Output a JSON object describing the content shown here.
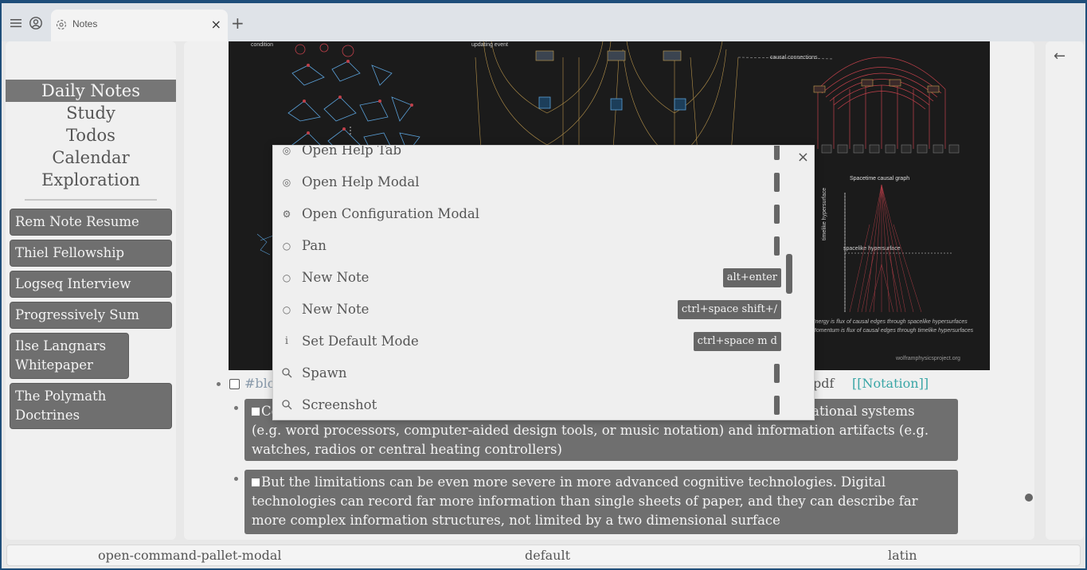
{
  "tab": {
    "title": "Notes",
    "close": "×",
    "new": "+"
  },
  "sidebar": {
    "nav": [
      {
        "label": "Daily Notes",
        "active": true
      },
      {
        "label": "Study"
      },
      {
        "label": "Todos"
      },
      {
        "label": "Calendar"
      },
      {
        "label": "Exploration"
      }
    ],
    "pages": [
      "Rem Note Resume",
      "Thiel Fellowship",
      "Logseq Interview",
      "Progressively Sum",
      "Ilse Langnars Whitepaper",
      "The Polymath Doctrines"
    ]
  },
  "figure": {
    "labels": {
      "condition": "condition",
      "updating_event": "updating event",
      "causal_connections": "causal connections",
      "spacetime_causal_graph": "Spacetime causal graph",
      "spacelike_hypersurface": "spacelike hypersurface",
      "timelike_hypersurface": "timelike hypersurface",
      "energy_caption": "Energy is flux of causal edges through spacelike hypersurfaces",
      "momentum_caption": "Momentum is flux of causal edges through timelike hypersurfaces",
      "credit": "wolframphysicsproject.org"
    }
  },
  "block": {
    "tag": "#blo",
    "file": "y.pdf",
    "link": "[[Notation]]",
    "quotes": [
      {
        "start": "Co",
        "end": "f notational systems",
        "rest": "(e.g. word processors, computer-aided design tools, or music notation) and information artifacts (e.g. watches, radios or central heating controllers)"
      },
      {
        "text": "But the limitations can be even more severe in more advanced cognitive technologies. Digital technologies can record far more information than single sheets of paper, and they can describe far more complex information structures, not limited by a two dimensional surface"
      }
    ]
  },
  "modal": {
    "close": "×",
    "commands": [
      {
        "icon": "help-icon",
        "glyph": "◎",
        "label": "Open Help Tab",
        "shortcut": ""
      },
      {
        "icon": "help-icon",
        "glyph": "◎",
        "label": "Open Help Modal",
        "shortcut": ""
      },
      {
        "icon": "gear-icon",
        "glyph": "⚙",
        "label": "Open Configuration Modal",
        "shortcut": ""
      },
      {
        "icon": "circle-icon",
        "glyph": "○",
        "label": "Pan",
        "shortcut": ""
      },
      {
        "icon": "circle-icon",
        "glyph": "○",
        "label": "New Note",
        "shortcut": "alt+enter"
      },
      {
        "icon": "circle-icon",
        "glyph": "○",
        "label": "New Note",
        "shortcut": "ctrl+space shift+/"
      },
      {
        "icon": "info-icon",
        "glyph": "i",
        "label": "Set Default Mode",
        "shortcut": "ctrl+space m d"
      },
      {
        "icon": "search-icon",
        "glyph": "⚲",
        "label": "Spawn",
        "shortcut": ""
      },
      {
        "icon": "search-icon",
        "glyph": "⚲",
        "label": "Screenshot",
        "shortcut": ""
      }
    ]
  },
  "statusbar": {
    "command": "open-command-pallet-modal",
    "mode": "default",
    "layout": "latin"
  },
  "colors": {
    "accent_gray": "#6f6f6f",
    "link_teal": "#3aa6a6",
    "figure_bg": "#1b1b1b",
    "graph_red": "#c0404a",
    "graph_blue": "#5aa0d8",
    "graph_gold": "#c8a050"
  }
}
